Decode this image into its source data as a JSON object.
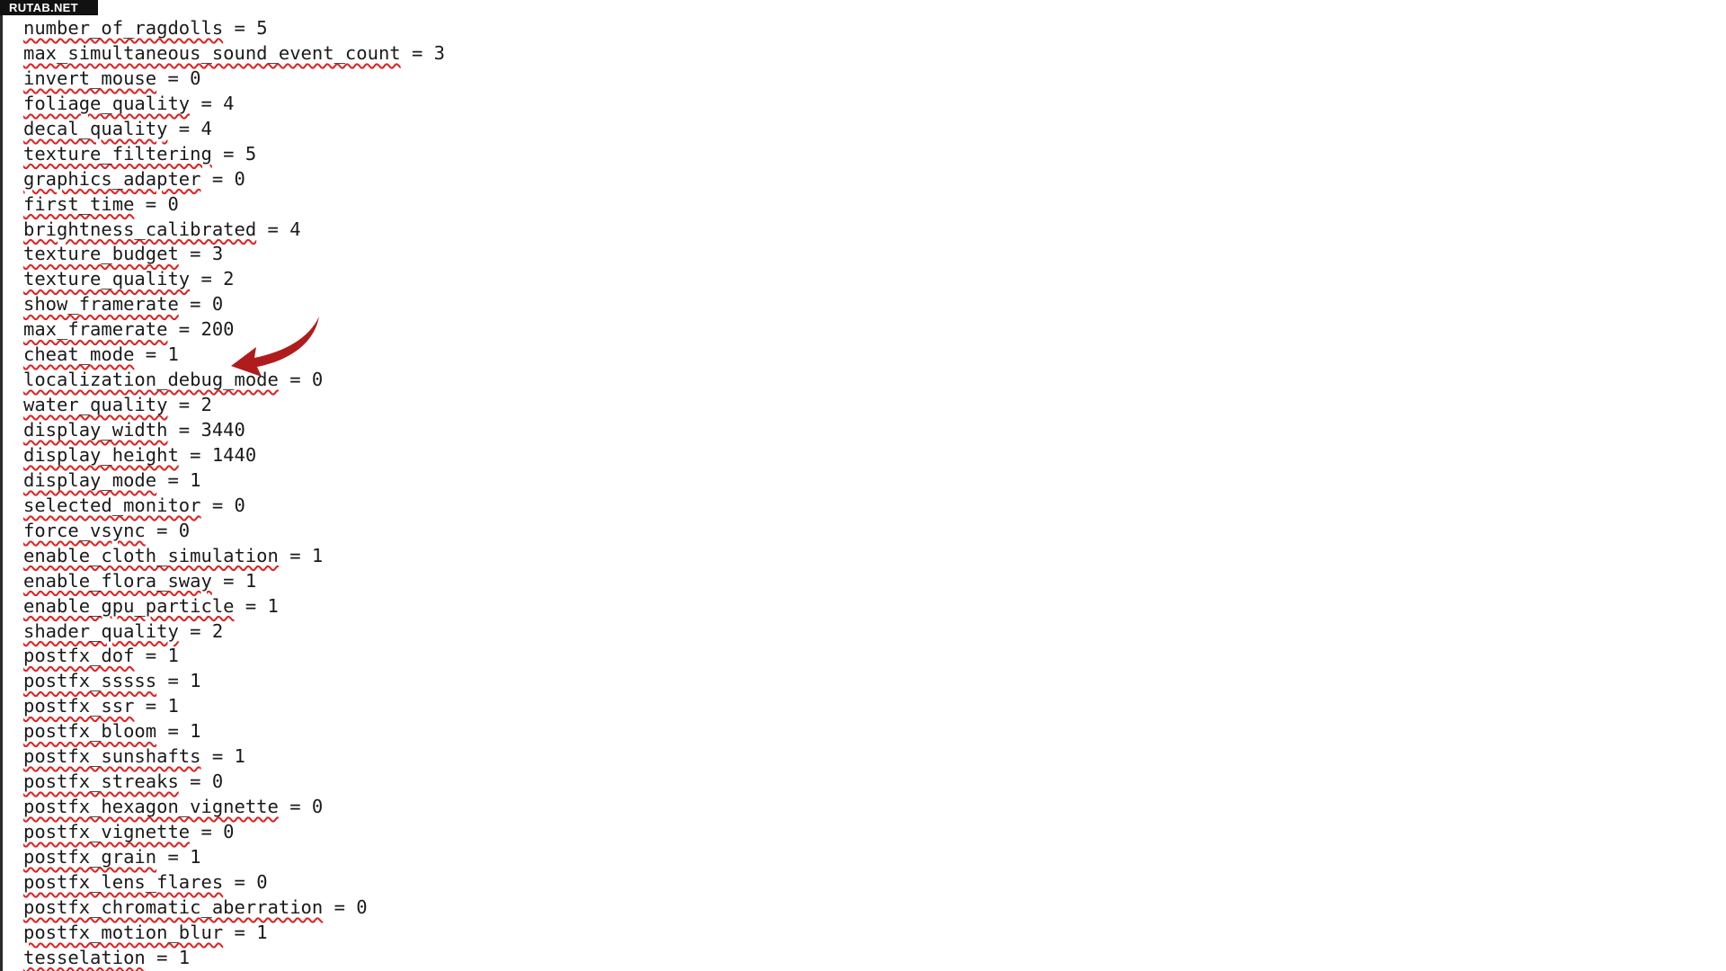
{
  "watermark": {
    "text": "RUTAB.NET"
  },
  "editor": {
    "arrow_icon": "red-curved-arrow",
    "arrow_color": "#b01c1c",
    "spell_underline_color": "#e02020",
    "lines": [
      {
        "key": "number_of_ragdolls",
        "value": "5"
      },
      {
        "key": "max_simultaneous_sound_event_count",
        "value": "3"
      },
      {
        "key": "invert_mouse",
        "value": "0"
      },
      {
        "key": "foliage_quality",
        "value": "4"
      },
      {
        "key": "decal_quality",
        "value": "4"
      },
      {
        "key": "texture_filtering",
        "value": "5"
      },
      {
        "key": "graphics_adapter",
        "value": "0"
      },
      {
        "key": "first_time",
        "value": "0"
      },
      {
        "key": "brightness_calibrated",
        "value": "4"
      },
      {
        "key": "texture_budget",
        "value": "3"
      },
      {
        "key": "texture_quality",
        "value": "2"
      },
      {
        "key": "show_framerate",
        "value": "0"
      },
      {
        "key": "max_framerate",
        "value": "200"
      },
      {
        "key": "cheat_mode",
        "value": "1"
      },
      {
        "key": "localization_debug_mode",
        "value": "0"
      },
      {
        "key": "water_quality",
        "value": "2"
      },
      {
        "key": "display_width",
        "value": "3440"
      },
      {
        "key": "display_height",
        "value": "1440"
      },
      {
        "key": "display_mode",
        "value": "1"
      },
      {
        "key": "selected_monitor",
        "value": "0"
      },
      {
        "key": "force_vsync",
        "value": "0"
      },
      {
        "key": "enable_cloth_simulation",
        "value": "1"
      },
      {
        "key": "enable_flora_sway",
        "value": "1"
      },
      {
        "key": "enable_gpu_particle",
        "value": "1"
      },
      {
        "key": "shader_quality",
        "value": "2"
      },
      {
        "key": "postfx_dof",
        "value": "1"
      },
      {
        "key": "postfx_sssss",
        "value": "1"
      },
      {
        "key": "postfx_ssr",
        "value": "1"
      },
      {
        "key": "postfx_bloom",
        "value": "1"
      },
      {
        "key": "postfx_sunshafts",
        "value": "1"
      },
      {
        "key": "postfx_streaks",
        "value": "0"
      },
      {
        "key": "postfx_hexagon_vignette",
        "value": "0"
      },
      {
        "key": "postfx_vignette",
        "value": "0"
      },
      {
        "key": "postfx_grain",
        "value": "1"
      },
      {
        "key": "postfx_lens_flares",
        "value": "0"
      },
      {
        "key": "postfx_chromatic_aberration",
        "value": "0"
      },
      {
        "key": "postfx_motion_blur",
        "value": "1"
      },
      {
        "key": "tesselation",
        "value": "1"
      }
    ]
  }
}
